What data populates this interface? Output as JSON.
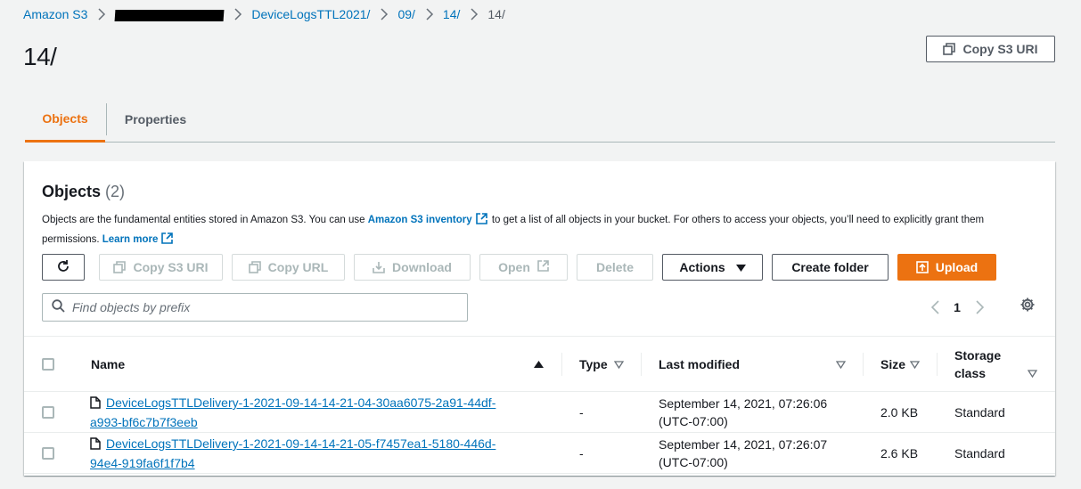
{
  "breadcrumbs": [
    {
      "label": "Amazon S3"
    },
    {
      "label": "DeviceLogsTTL2021/"
    },
    {
      "label": "09/"
    },
    {
      "label": "14/"
    },
    {
      "label": "14/"
    }
  ],
  "page_title": "14/",
  "copy_s3_uri_label": "Copy S3 URI",
  "tabs": [
    {
      "label": "Objects",
      "active": true
    },
    {
      "label": "Properties",
      "active": false
    }
  ],
  "objects_panel": {
    "title": "Objects",
    "count": "(2)",
    "desc_part1": "Objects are the fundamental entities stored in Amazon S3. You can use ",
    "inventory_link": "Amazon S3 inventory",
    "desc_part2": " to get a list of all objects in your bucket. For others to access your objects, you’ll need to explicitly grant them permissions. ",
    "learn_more": "Learn more"
  },
  "toolbar": {
    "copy_s3_uri": "Copy S3 URI",
    "copy_url": "Copy URL",
    "download": "Download",
    "open": "Open",
    "delete": "Delete",
    "actions": "Actions",
    "create_folder": "Create folder",
    "upload": "Upload"
  },
  "search": {
    "placeholder": "Find objects by prefix",
    "value": ""
  },
  "pagination": {
    "current_page": "1"
  },
  "table": {
    "columns": {
      "name": "Name",
      "type": "Type",
      "last_modified": "Last modified",
      "size": "Size",
      "storage_class_line1": "Storage",
      "storage_class_line2": "class"
    },
    "rows": [
      {
        "name_line1": "DeviceLogsTTLDelivery-1-2021-09-14-14-21-04-30aa6075-2a91-44df-",
        "name_line2": "a993-bf6c7b7f3eeb",
        "type": "-",
        "modified_line1": "September 14, 2021, 07:26:06",
        "modified_line2": "(UTC-07:00)",
        "size": "2.0 KB",
        "storage_class": "Standard"
      },
      {
        "name_line1": "DeviceLogsTTLDelivery-1-2021-09-14-14-21-05-f7457ea1-5180-446d-",
        "name_line2": "94e4-919fa6f1f7b4",
        "type": "-",
        "modified_line1": "September 14, 2021, 07:26:07",
        "modified_line2": "(UTC-07:00)",
        "size": "2.6 KB",
        "storage_class": "Standard"
      }
    ]
  },
  "colors": {
    "accent": "#ec7211",
    "link": "#0073bb",
    "text": "#16191f",
    "secondary_text": "#545b64",
    "background": "#f2f3f3"
  },
  "icons": [
    "chevron-right-icon",
    "copy-icon",
    "refresh-icon",
    "download-icon",
    "external-link-icon",
    "caret-down-icon",
    "upload-icon",
    "search-icon",
    "chevron-left-icon",
    "gear-icon",
    "sort-up-icon",
    "sort-down-icon",
    "file-icon"
  ]
}
